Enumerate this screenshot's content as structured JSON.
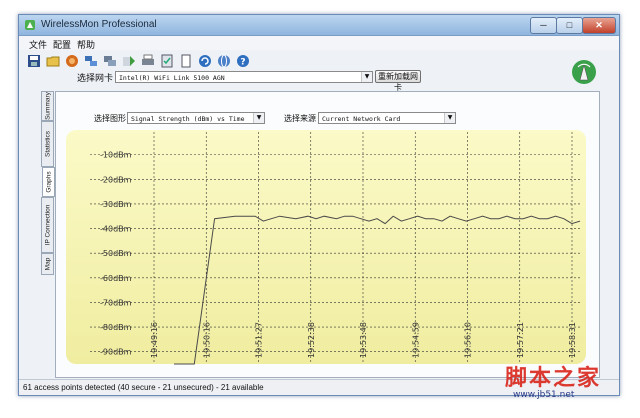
{
  "window": {
    "title": "WirelessMon Professional",
    "min_label": "─",
    "max_label": "□",
    "close_label": "✕"
  },
  "menu": [
    "文件",
    "配置",
    "帮助"
  ],
  "toolbar": {
    "icons": [
      "save-icon",
      "open-folder-icon",
      "globe-icon",
      "network-icon",
      "computers-icon",
      "export-icon",
      "print-icon",
      "settings-icon",
      "copy-icon",
      "refresh-icon",
      "web-icon",
      "help-icon"
    ]
  },
  "adapter": {
    "label": "选择网卡",
    "value": "Intel(R) WiFi Link 5100 AGN",
    "button": "重新加载网卡"
  },
  "tabs": [
    "Summary",
    "Statistics",
    "Graphs",
    "IP Connection",
    "Map"
  ],
  "graph": {
    "type_label": "选择图形",
    "type_value": "Signal Strength (dBm) vs Time",
    "source_label": "选择来源",
    "source_value": "Current Network Card"
  },
  "chart_data": {
    "type": "line",
    "ylabel": "",
    "ylim": [
      -95,
      0
    ],
    "yticks": [
      "-10dBm",
      "-20dBm",
      "-30dBm",
      "-40dBm",
      "-50dBm",
      "-60dBm",
      "-70dBm",
      "-80dBm",
      "-90dBm"
    ],
    "ytick_values": [
      -10,
      -20,
      -30,
      -40,
      -50,
      -60,
      -70,
      -80,
      -90
    ],
    "xticks": [
      "19:49:16",
      "19:50:16",
      "19:51:27",
      "19:52:38",
      "19:53:48",
      "19:54:59",
      "19:56:10",
      "19:57:21",
      "19:58:31"
    ],
    "series": [
      {
        "color": "#4a4a4a",
        "x": [
          0.0,
          0.05,
          0.1,
          0.15,
          0.2,
          0.22,
          0.26,
          0.3,
          0.33,
          0.35,
          0.37,
          0.4,
          0.42,
          0.44,
          0.46,
          0.48,
          0.5,
          0.52,
          0.54,
          0.56,
          0.58,
          0.6,
          0.62,
          0.64,
          0.66,
          0.68,
          0.7,
          0.72,
          0.74,
          0.76,
          0.78,
          0.8,
          0.82,
          0.84,
          0.86,
          0.88,
          0.9,
          0.92,
          0.94,
          0.96,
          0.98,
          1.0
        ],
        "y": [
          -95,
          -95,
          -36,
          -35,
          -35,
          -37,
          -35,
          -36,
          -35,
          -36,
          -35,
          -36,
          -35,
          -35,
          -36,
          -37,
          -36,
          -38,
          -35,
          -37,
          -36,
          -35,
          -36,
          -36,
          -37,
          -35,
          -36,
          -37,
          -36,
          -35,
          -36,
          -36,
          -35,
          -36,
          -36,
          -35,
          -36,
          -36,
          -35,
          -36,
          -38,
          -37
        ]
      }
    ]
  },
  "status": "61 access points detected (40 secure - 21 unsecured) - 21 available",
  "watermark": {
    "text": "脚本之家",
    "url": "www.jb51.net"
  },
  "colors": {
    "chart_bg_top": "#fbfac8",
    "chart_bg_bottom": "#f0eda0",
    "grid": "#333333",
    "line": "#4a4a4a"
  }
}
